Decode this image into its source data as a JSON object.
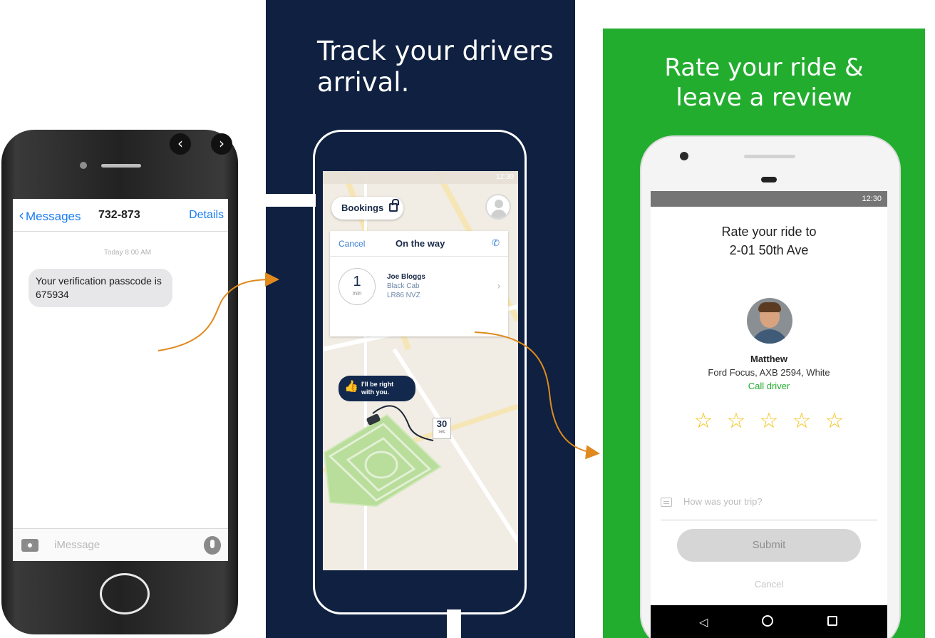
{
  "panel1": {
    "header": {
      "back_label": "Messages",
      "contact": "732-873",
      "details_label": "Details"
    },
    "timestamp": "Today 8:00 AM",
    "message": "Your verification passcode is 675934",
    "input_placeholder": "iMessage",
    "nav_prev": "‹",
    "nav_next": "›"
  },
  "panel2": {
    "title_line1": "Track your drivers",
    "title_line2": "arrival.",
    "status_time": "12:30",
    "bookings_label": "Bookings",
    "card": {
      "cancel_label": "Cancel",
      "status": "On the way",
      "eta_value": "1",
      "eta_unit": "min",
      "driver_name": "Joe Bloggs",
      "vehicle": "Black Cab",
      "plate": "LR86 NVZ"
    },
    "bubble_line1": "I'll be right",
    "bubble_line2": "with you.",
    "countdown_value": "30",
    "countdown_unit": "sec"
  },
  "panel3": {
    "title_line1": "Rate your ride &",
    "title_line2": "leave a review",
    "status_time": "12:30",
    "rate_line1": "Rate your ride to",
    "rate_line2": "2-01 50th Ave",
    "driver_name": "Matthew",
    "car_info": "Ford Focus, AXB 2594, White",
    "call_label": "Call driver",
    "rating_stars": 5,
    "rating_selected": 0,
    "trip_placeholder": "How was your trip?",
    "submit_label": "Submit",
    "cancel_label": "Cancel"
  },
  "colors": {
    "ios_blue": "#1a7cf3",
    "navy_bg": "#0f2040",
    "green_bg": "#23ad2f",
    "star_yellow": "#f2c318",
    "arrow_orange": "#e08a1e"
  }
}
